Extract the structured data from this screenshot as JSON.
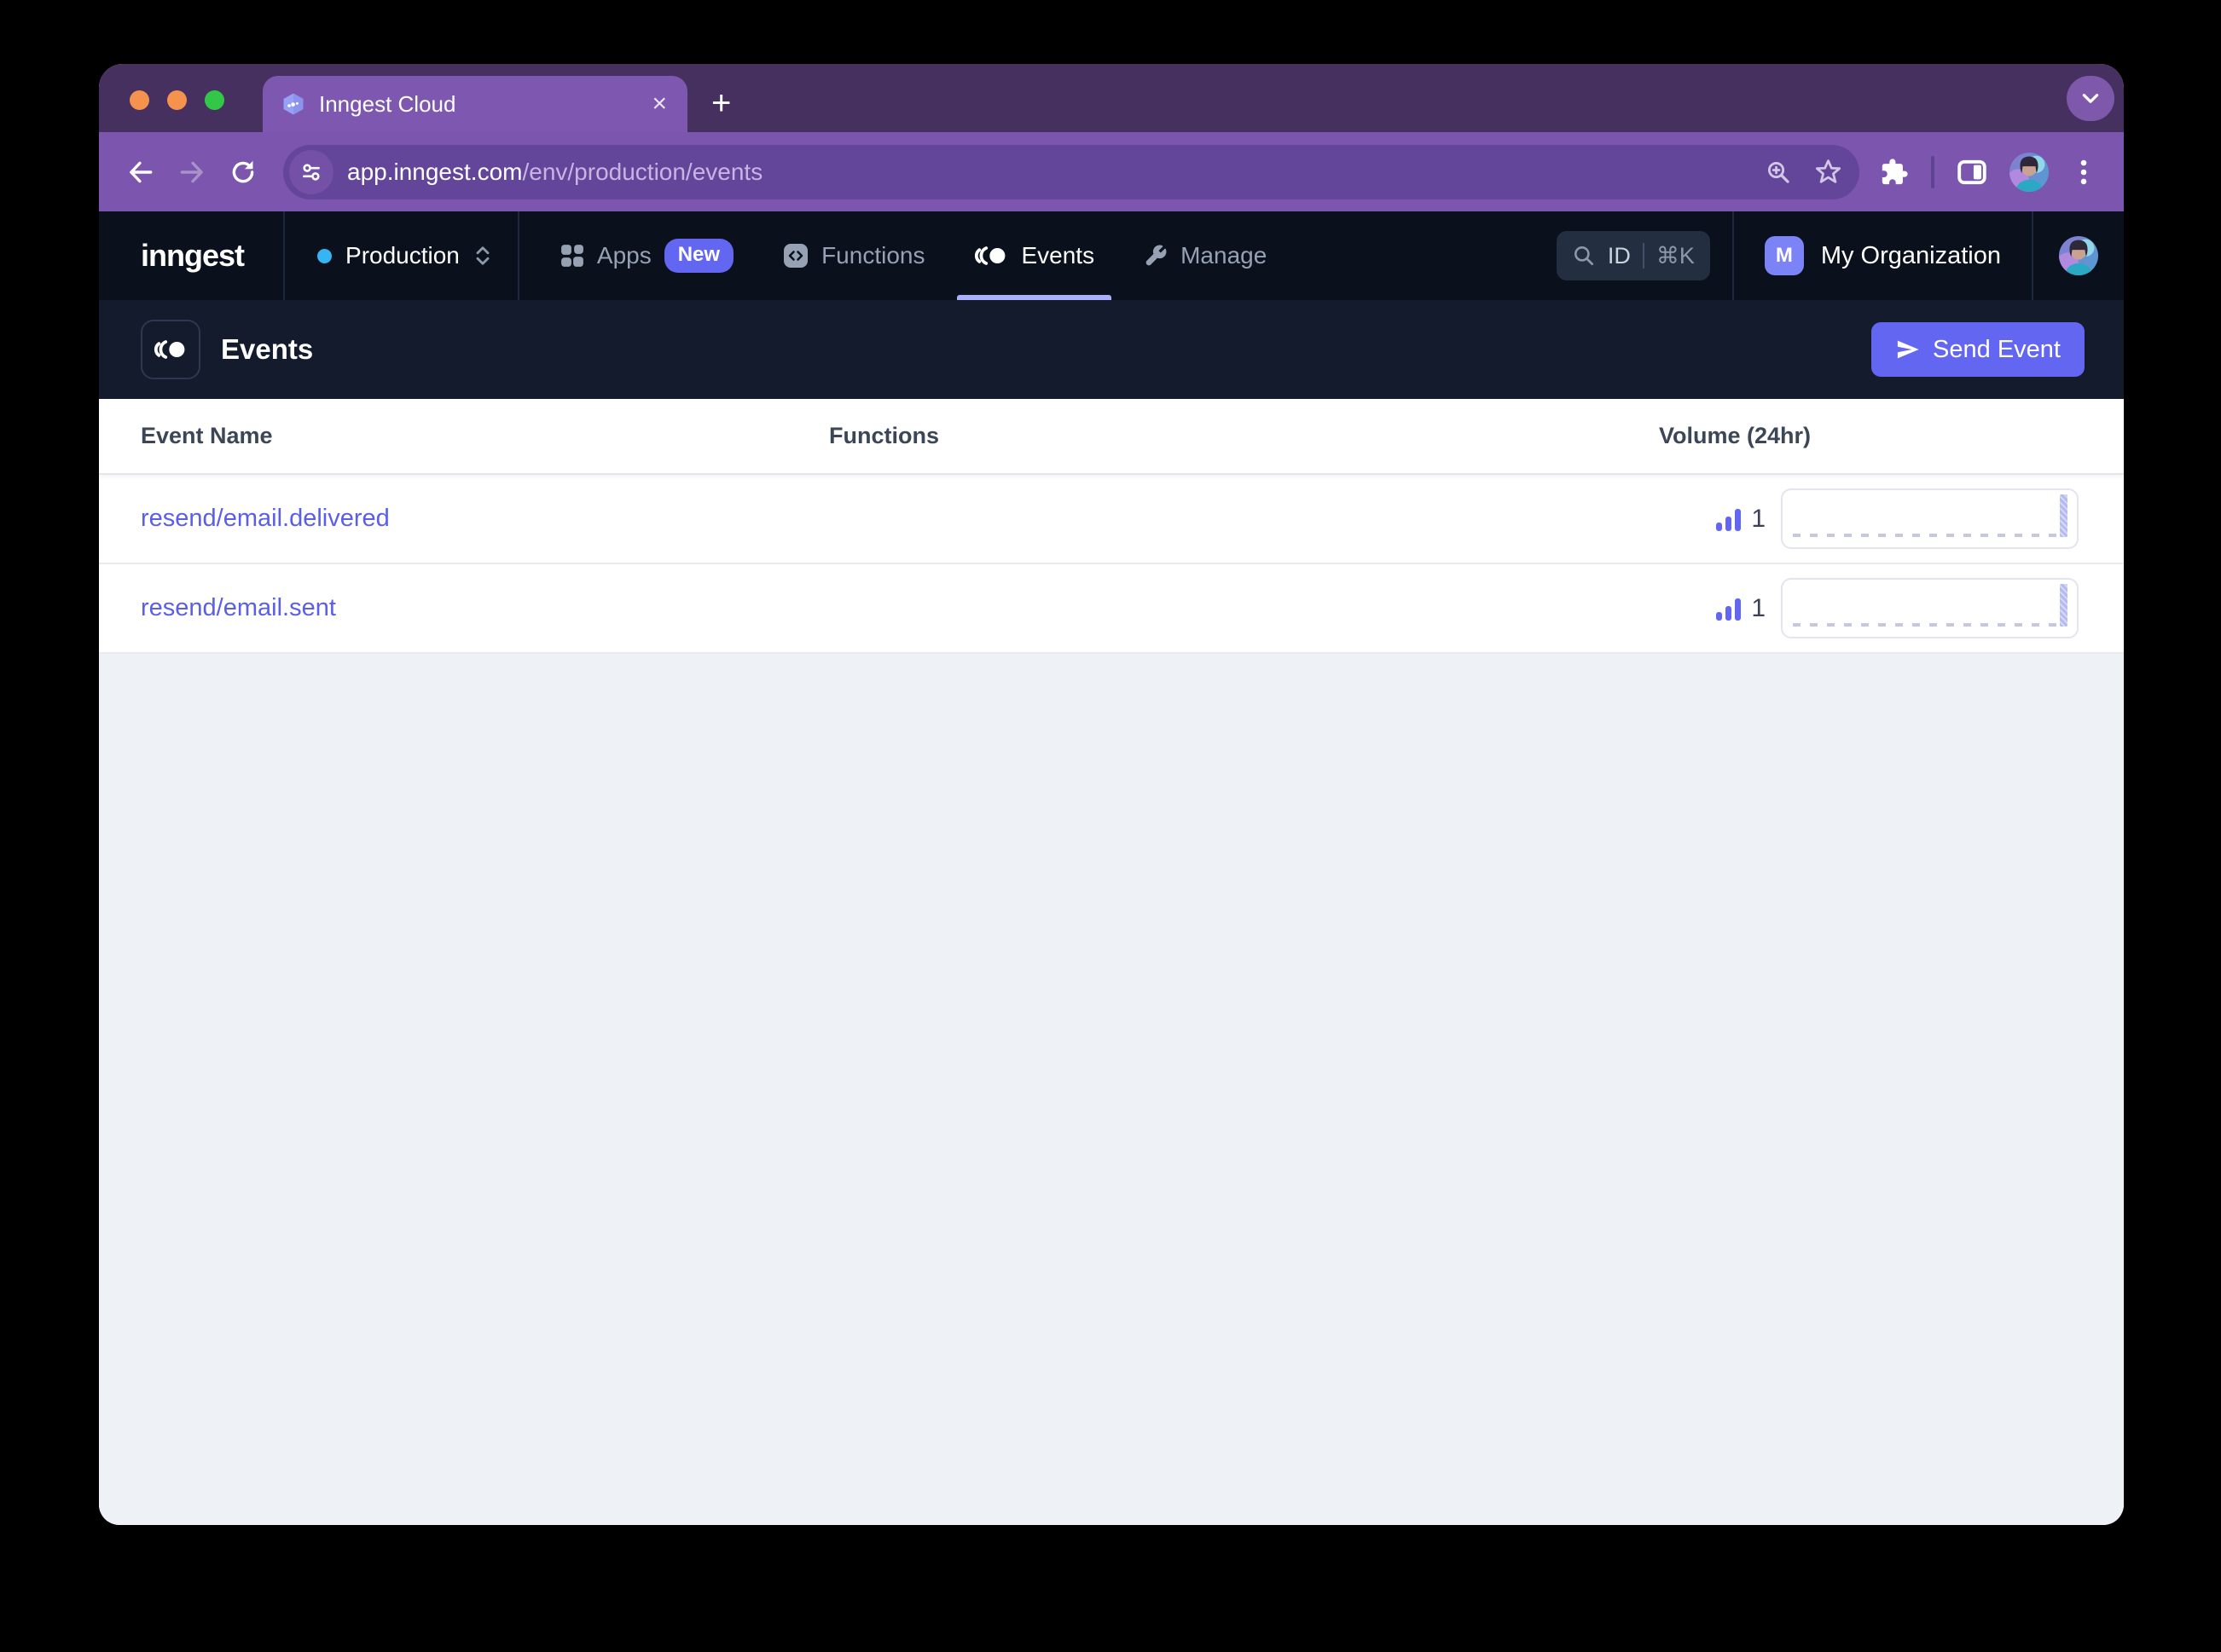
{
  "browser": {
    "tab_title": "Inngest Cloud",
    "close_tab": "×",
    "new_tab": "+",
    "url_host": "app.inngest.com",
    "url_path": "/env/production/events"
  },
  "nav": {
    "logo": "inngest",
    "env": {
      "label": "Production"
    },
    "items": {
      "apps": {
        "label": "Apps",
        "badge": "New"
      },
      "functions": {
        "label": "Functions"
      },
      "events": {
        "label": "Events",
        "active": true
      },
      "manage": {
        "label": "Manage"
      }
    },
    "search": {
      "label": "ID",
      "shortcut": "⌘K"
    },
    "org": {
      "initial": "M",
      "name": "My Organization"
    }
  },
  "page": {
    "title": "Events",
    "send_button": "Send Event"
  },
  "table": {
    "columns": [
      "Event Name",
      "Functions",
      "Volume (24hr)"
    ],
    "rows": [
      {
        "name": "resend/email.delivered",
        "functions": "",
        "volume": "1",
        "spark": {
          "points_24h": "flat at 0 with single bar of height 1 in the most recent slot",
          "last_value": 1
        }
      },
      {
        "name": "resend/email.sent",
        "functions": "",
        "volume": "1",
        "spark": {
          "points_24h": "flat at 0 with single bar of height 1 in the most recent slot",
          "last_value": 1
        }
      }
    ]
  },
  "colors": {
    "accent_indigo": "#6366f1",
    "event_link": "#5a5ee8",
    "active_tab_underline": "#a7b0f8",
    "env_dot": "#35b5f2",
    "org_badge": "#7b83f6",
    "browser_toolbar": "#7b55ae",
    "browser_tabstrip": "#463060",
    "app_nav_bg": "#0b101d",
    "page_header_bg": "#131b2d",
    "content_bg": "#eef1f6",
    "traffic_light_1": "#f5924d",
    "traffic_light_2": "#f5924d",
    "traffic_light_3": "#33c748"
  }
}
